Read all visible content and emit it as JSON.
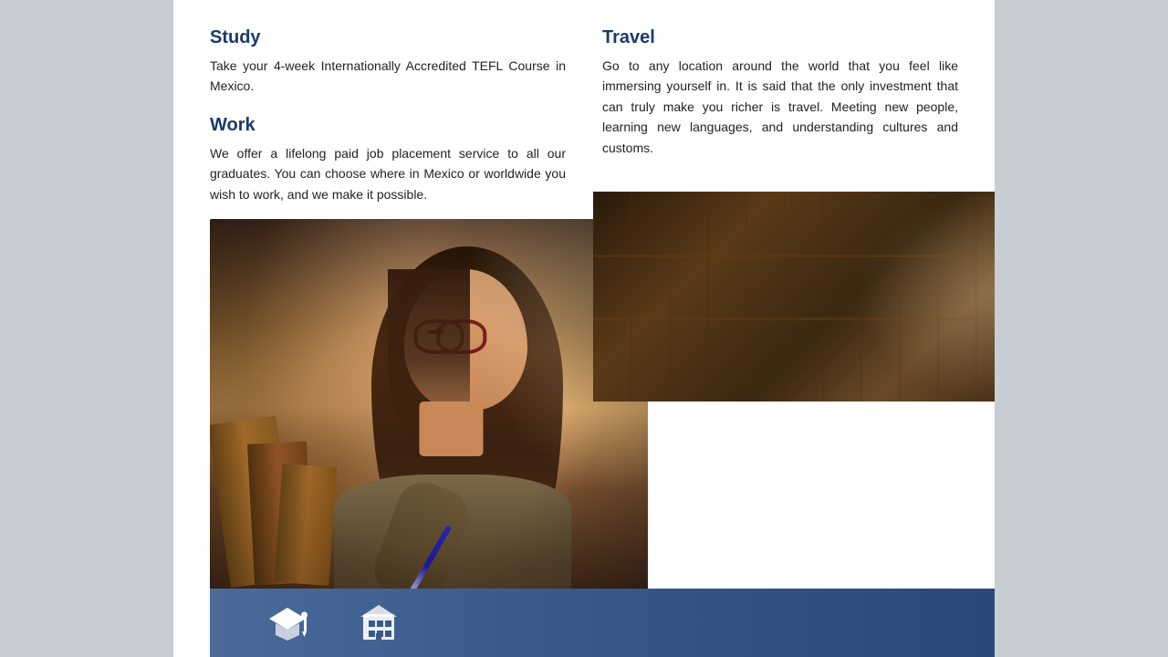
{
  "page": {
    "background_color": "#c8cdd4",
    "content_background": "#ffffff"
  },
  "left_column": {
    "study": {
      "title": "Study",
      "title_color": "#1a3a6b",
      "body": "Take your 4-week Internationally Accredited TEFL Course in Mexico."
    },
    "work": {
      "title": "Work",
      "title_color": "#1a3a6b",
      "body": "We offer a lifelong paid job placement service to all our graduates. You can choose where in Mexico or worldwide you wish to work, and we make it possible."
    }
  },
  "right_column": {
    "travel": {
      "title": "Travel",
      "title_color": "#1a3a6b",
      "body": "Go to any location around the world that you feel like immersing yourself in. It is said that the only investment that can truly make you richer is travel. Meeting new people, learning new languages, and understanding cultures and customs."
    }
  },
  "bottom_bar": {
    "background": "#3a5a8a"
  },
  "icons": {
    "graduation_cap": "🎓",
    "building": "🏛"
  }
}
